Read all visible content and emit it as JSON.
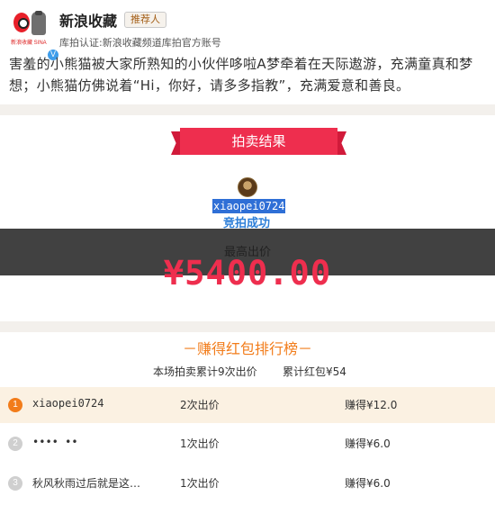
{
  "header": {
    "name": "新浪收藏",
    "tag": "推荐人",
    "logo_text": "新浪收藏 SINA",
    "verified_mark": "V",
    "cert": "库拍认证:新浪收藏频道库拍官方账号"
  },
  "description": "害羞的小熊猫被大家所熟知的小伙伴哆啦A梦牵着在天际遨游，充满童真和梦想；小熊猫仿佛说着“Hi，你好，请多多指教”，充满爱意和善良。",
  "result": {
    "ribbon_label": "拍卖结果",
    "winner": "xiaopei0724",
    "status": "竞拍成功",
    "price_label": "最高出价",
    "price": "¥5400.00"
  },
  "ranking": {
    "title": "－赚得红包排行榜－",
    "summary_bids": "本场拍卖累计9次出价",
    "summary_total": "累计红包¥54",
    "rows": [
      {
        "rank": "1",
        "user": "xiaopei0724",
        "bids": "2次出价",
        "earned": "赚得¥12.0"
      },
      {
        "rank": "2",
        "user": "•••• ••",
        "bids": "1次出价",
        "earned": "赚得¥6.0"
      },
      {
        "rank": "3",
        "user": "秋风秋雨过后就是这…",
        "bids": "1次出价",
        "earned": "赚得¥6.0"
      }
    ]
  },
  "colors": {
    "accent_red": "#ee2e4e",
    "accent_orange": "#f27c1a",
    "link_blue": "#2e7fd8",
    "highlight_row": "#fbf1e2"
  }
}
